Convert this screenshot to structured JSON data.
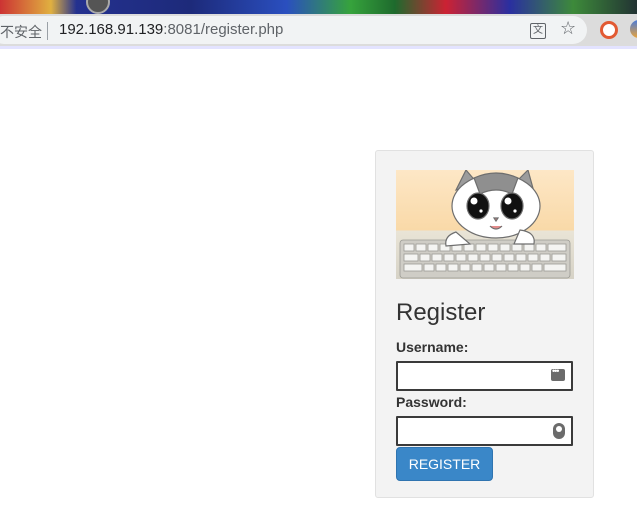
{
  "browser": {
    "security_label": "不安全",
    "url_host": "192.168.91.139",
    "url_rest": ":8081/register.php"
  },
  "form": {
    "title": "Register",
    "username_label": "Username:",
    "username_value": "",
    "password_label": "Password:",
    "password_value": "",
    "submit_label": "REGISTER"
  },
  "icons": {
    "translate": "translate-icon",
    "bookmark": "star-icon",
    "extension": "extension-icon",
    "username_field": "keyboard-icon",
    "password_field": "key-icon"
  },
  "colors": {
    "button": "#3a87c8",
    "card": "#f3f3f3"
  }
}
